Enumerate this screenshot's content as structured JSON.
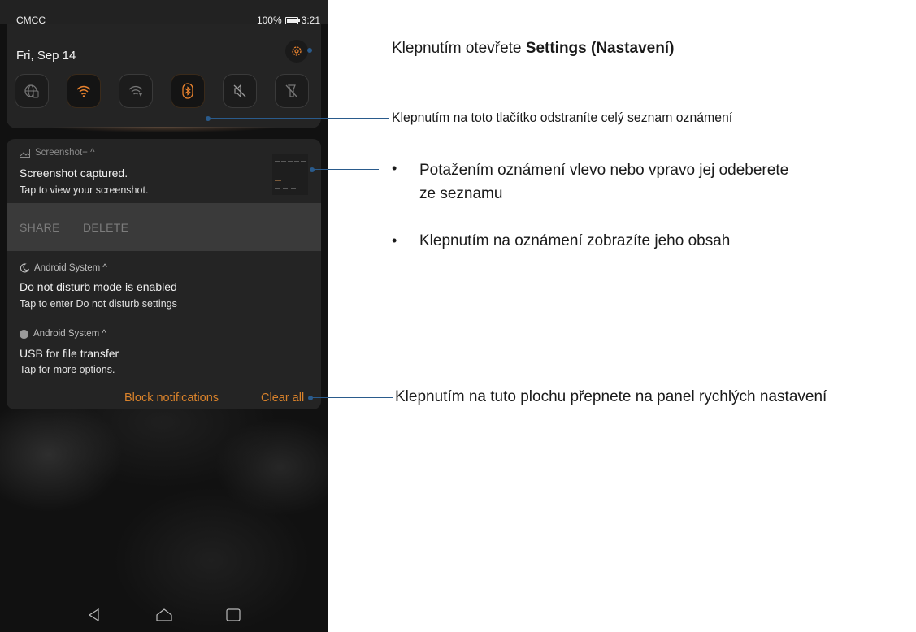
{
  "status_bar": {
    "carrier": "CMCC",
    "battery": "100%",
    "time": "3:21"
  },
  "quick_settings": {
    "date": "Fri, Sep 14",
    "settings_icon": "gear-icon",
    "toggles": [
      {
        "icon": "globe-icon",
        "state": "off"
      },
      {
        "icon": "wifi-icon",
        "state": "on"
      },
      {
        "icon": "wifi-hotspot-icon",
        "state": "off"
      },
      {
        "icon": "bluetooth-icon",
        "state": "on"
      },
      {
        "icon": "sound-muted-icon",
        "state": "off"
      },
      {
        "icon": "flashlight-off-icon",
        "state": "off"
      }
    ],
    "accent_color": "#e8822e"
  },
  "notifications": [
    {
      "app": "Screenshot+ ^",
      "icon": "image-icon",
      "title": "Screenshot captured.",
      "text": "Tap to view your screenshot.",
      "actions": [
        "SHARE",
        "DELETE"
      ]
    },
    {
      "app": "Android System ^",
      "icon": "moon-icon",
      "title": "Do not disturb mode is enabled",
      "text": "Tap to enter Do not disturb settings"
    },
    {
      "app": "Android System ^",
      "icon": "usb-dot-icon",
      "title": "USB for file transfer",
      "text": "Tap for more options."
    }
  ],
  "footer": {
    "block_label": "Block notifications",
    "clear_label": "Clear all"
  },
  "nav_bar": [
    "back-icon",
    "home-icon",
    "recents-icon"
  ],
  "callouts": {
    "settings": {
      "prefix": "Klepnutím otevřete ",
      "bold": "Settings (Nastavení)"
    },
    "clear_all": "Klepnutím na toto tlačítko odstraníte celý seznam oznámení",
    "bullets": [
      "Potažením oznámení vlevo nebo vpravo jej odeberete ze seznamu",
      "Klepnutím na oznámení zobrazíte jeho obsah"
    ],
    "quick_settings": "Klepnutím na tuto plochu přepnete na panel rychlých nastavení",
    "line_color": "#2a5b8c"
  }
}
